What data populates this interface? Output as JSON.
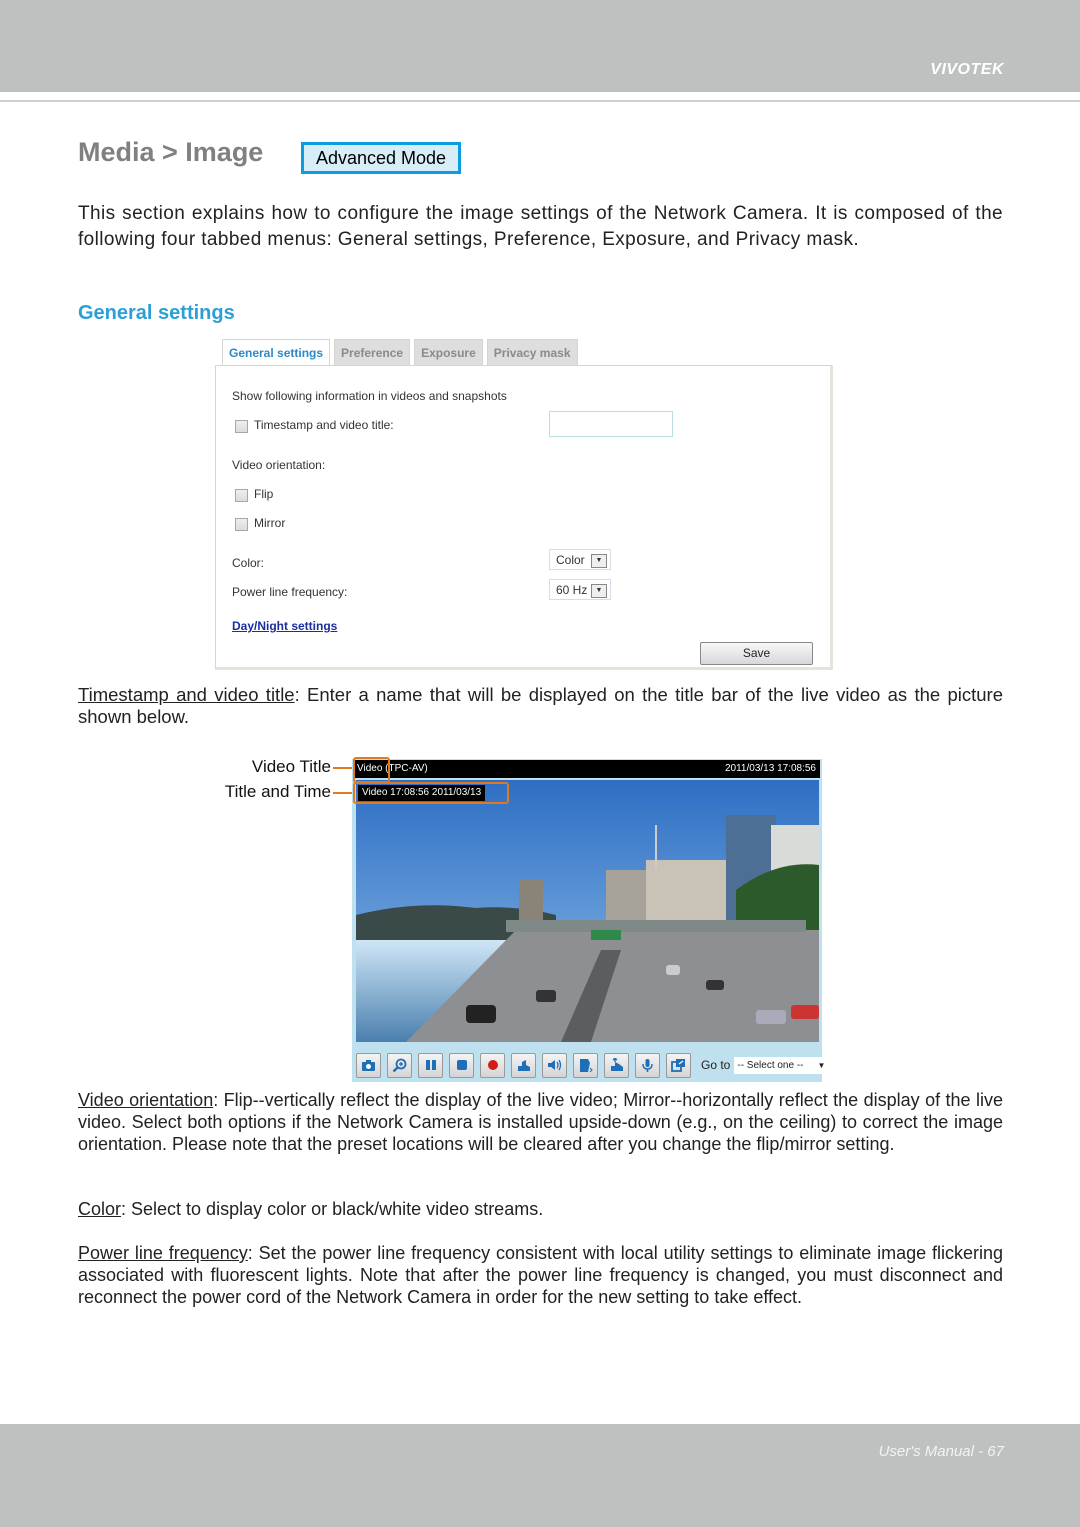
{
  "header": {
    "brand": "VIVOTEK"
  },
  "page": {
    "title": "Media > Image",
    "advanced_mode_label": "Advanced Mode",
    "intro": "This section explains how to configure the image settings of the Network Camera. It is composed of the following four tabbed menus: General settings, Preference, Exposure, and Privacy mask.",
    "section_heading": "General settings"
  },
  "settings_panel": {
    "tabs": [
      {
        "label": "General settings",
        "active": true
      },
      {
        "label": "Preference",
        "active": false
      },
      {
        "label": "Exposure",
        "active": false
      },
      {
        "label": "Privacy mask",
        "active": false
      }
    ],
    "show_info_label": "Show following information in videos and snapshots",
    "timestamp_label": "Timestamp and video title:",
    "timestamp_checked": false,
    "timestamp_value": "",
    "orientation_label": "Video orientation:",
    "flip_label": "Flip",
    "flip_checked": false,
    "mirror_label": "Mirror",
    "mirror_checked": false,
    "color_label": "Color:",
    "color_value": "Color",
    "power_label": "Power line frequency:",
    "power_value": "60 Hz",
    "day_night_link": "Day/Night settings",
    "save_label": "Save"
  },
  "timestamp_desc": {
    "term": "Timestamp and video title",
    "text": ": Enter a name that will be displayed on the title bar of the live video as the picture shown below."
  },
  "video_figure": {
    "callout_video_title": "Video Title",
    "callout_title_time": "Title and Time",
    "title_bar_text": "Video (TPC-AV)",
    "title_bar_datetime": "2011/03/13  17:08:56",
    "overlay_text": "Video 17:08:56  2011/03/13",
    "goto_label": "Go to",
    "goto_select": "-- Select one --",
    "controls": [
      "snapshot-icon",
      "digital-zoom-icon",
      "pause-icon",
      "stop-icon",
      "record-icon",
      "volume-icon",
      "speaker-icon",
      "talk-icon",
      "mic-volume-icon",
      "mic-icon",
      "fullscreen-icon"
    ]
  },
  "descriptions": {
    "orientation_term": "Video orientation",
    "orientation_text": ": Flip--vertically reflect the display of the live video; Mirror--horizontally reflect the display of the live video. Select both options if the Network Camera is installed upside-down (e.g., on the ceiling) to correct the image orientation. Please note that the preset locations will be cleared after you change the flip/mirror setting.",
    "color_term": "Color",
    "color_text": ": Select to display color or black/white video streams.",
    "power_term": "Power line frequency",
    "power_text": ": Set the power line frequency consistent with local utility settings to eliminate image flickering associated with fluorescent lights. Note that after the power line frequency is changed, you must disconnect and reconnect the power cord of the Network Camera in order for the new setting to take effect."
  },
  "footer": {
    "text": "User's Manual - 67"
  }
}
